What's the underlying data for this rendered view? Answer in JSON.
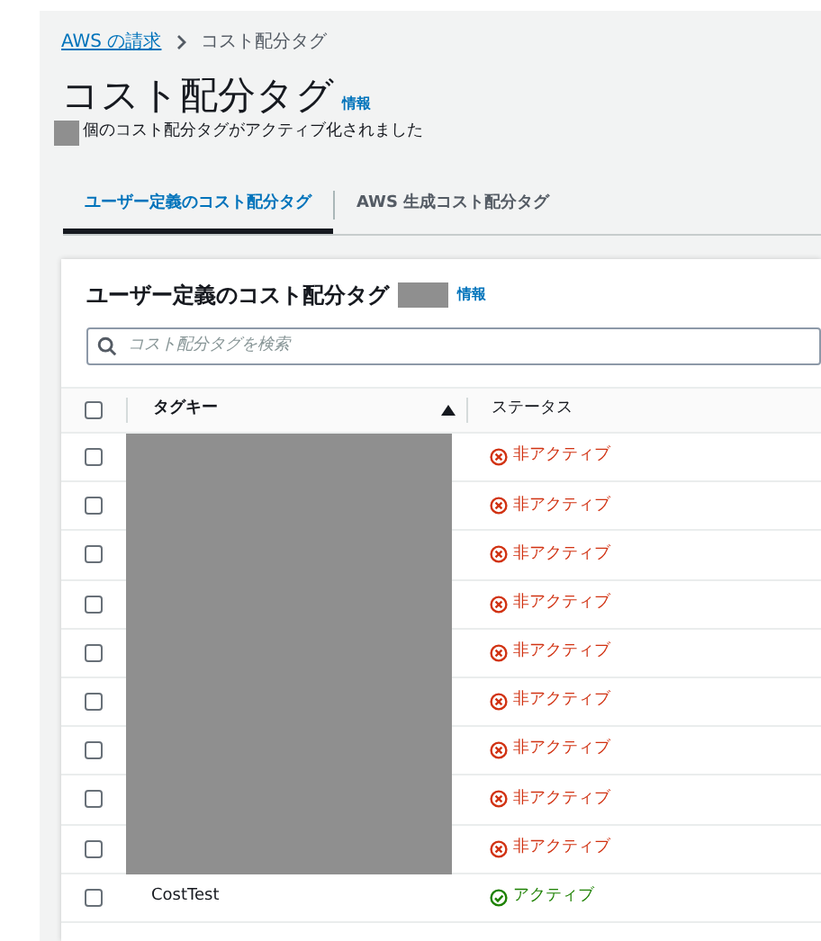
{
  "breadcrumb": [
    {
      "label": "AWS の請求",
      "link": true
    },
    {
      "label": "コスト配分タグ",
      "link": false
    }
  ],
  "page": {
    "title": "コスト配分タグ",
    "info": "情報",
    "count_redacted": true,
    "summary": "個のコスト配分タグがアクティブ化されました"
  },
  "tabs": [
    {
      "label": "ユーザー定義のコスト配分タグ",
      "selected": true
    },
    {
      "label": "AWS 生成コスト配分タグ",
      "selected": false
    }
  ],
  "panel": {
    "title": "ユーザー定義のコスト配分タグ",
    "count_redacted": true,
    "info": "情報",
    "search": {
      "placeholder": "コスト配分タグを検索"
    }
  },
  "table": {
    "all_checked": false,
    "columns": [
      "タグキー",
      "ステータス"
    ],
    "rows": [
      {
        "checked": false,
        "redacted": true,
        "status": {
          "kind": "inactive",
          "label": "非アクティブ"
        }
      },
      {
        "checked": false,
        "redacted": true,
        "status": {
          "kind": "inactive",
          "label": "非アクティブ"
        }
      },
      {
        "checked": false,
        "redacted": true,
        "status": {
          "kind": "inactive",
          "label": "非アクティブ"
        }
      },
      {
        "checked": false,
        "redacted": true,
        "status": {
          "kind": "inactive",
          "label": "非アクティブ"
        }
      },
      {
        "checked": false,
        "redacted": true,
        "status": {
          "kind": "inactive",
          "label": "非アクティブ"
        }
      },
      {
        "checked": false,
        "redacted": true,
        "status": {
          "kind": "inactive",
          "label": "非アクティブ"
        }
      },
      {
        "checked": false,
        "redacted": true,
        "status": {
          "kind": "inactive",
          "label": "非アクティブ"
        }
      },
      {
        "checked": false,
        "redacted": true,
        "status": {
          "kind": "inactive",
          "label": "非アクティブ"
        }
      },
      {
        "checked": false,
        "redacted": true,
        "status": {
          "kind": "inactive",
          "label": "非アクティブ"
        }
      },
      {
        "checked": false,
        "redacted": false,
        "key": "CostTest",
        "status": {
          "kind": "active",
          "label": "アクティブ"
        }
      }
    ]
  }
}
